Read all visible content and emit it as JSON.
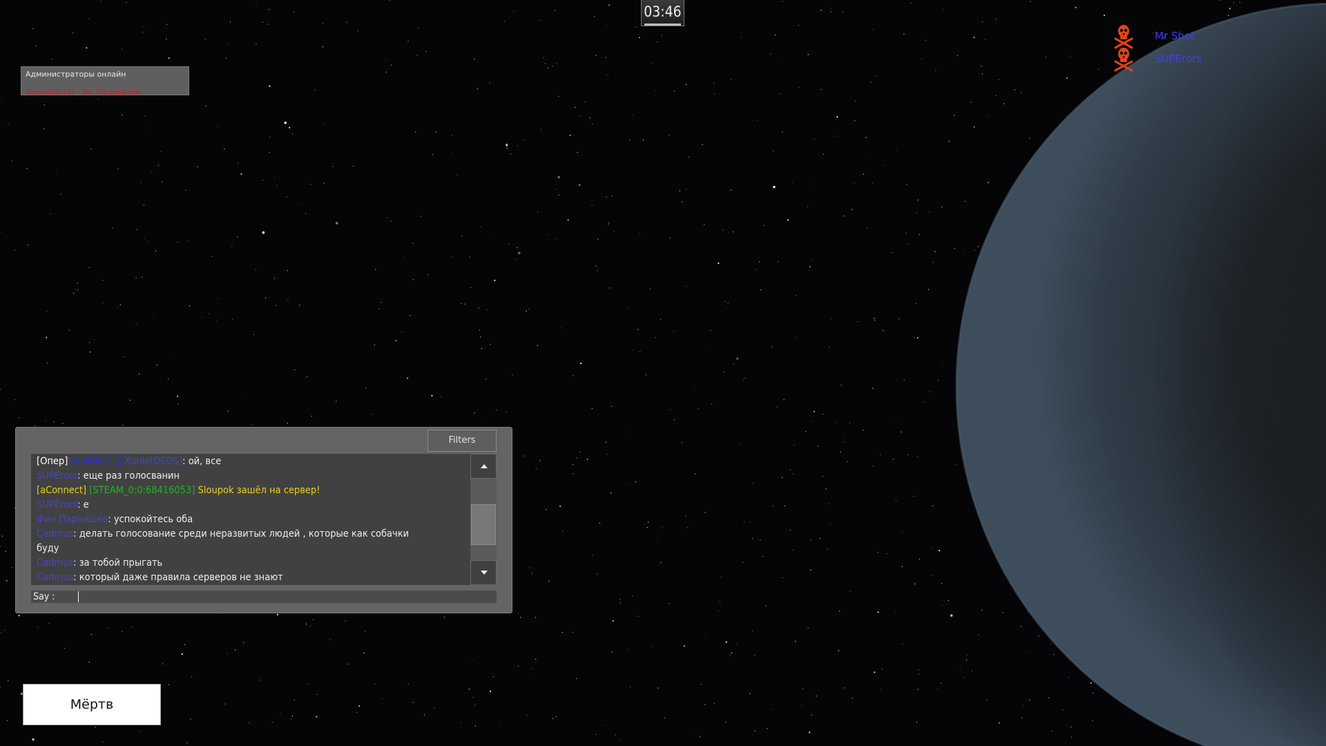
{
  "timer": {
    "value": "03:46"
  },
  "admins_panel": {
    "title": "Администраторы онлайн",
    "entry": "Xonie[DEOS] - Ур. Модератор"
  },
  "killfeed": [
    {
      "name": "Mr Shot"
    },
    {
      "name": "SUPErors"
    }
  ],
  "chat": {
    "filters_label": "Filters",
    "lines": [
      {
        "segments": [
          {
            "text": "[Опер] ",
            "color": "#ffffff"
          },
          {
            "text": "[ADMIN L1] ",
            "color": "#2a2af0"
          },
          {
            "text": "Xonie[DEOS]",
            "color": "#4444c8"
          },
          {
            "text": ": ой, все",
            "color": "#eeeeee"
          }
        ]
      },
      {
        "segments": [
          {
            "text": "SUPErors",
            "color": "#4444c8"
          },
          {
            "text": ": еще раз голосванин",
            "color": "#eeeeee"
          }
        ]
      },
      {
        "segments": [
          {
            "text": "[aConnect] ",
            "color": "#e8d21a"
          },
          {
            "text": "[STEAM_0:0:68416053] ",
            "color": "#22b422"
          },
          {
            "text": "Sloupok ",
            "color": "#e8d21a"
          },
          {
            "text": "зашёл на сервер!",
            "color": "#e8d21a"
          }
        ]
      },
      {
        "segments": [
          {
            "text": "SUPErors",
            "color": "#4444c8"
          },
          {
            "text": ": е",
            "color": "#eeeeee"
          }
        ]
      },
      {
        "segments": [
          {
            "text": "Фин Парнишка",
            "color": "#4444c8"
          },
          {
            "text": ": успокойтесь оба",
            "color": "#eeeeee"
          }
        ]
      },
      {
        "segments": [
          {
            "text": "Cadmus",
            "color": "#4444c8"
          },
          {
            "text": ": делать голосование среди неразвитых людей , которые как собачки",
            "color": "#eeeeee"
          }
        ]
      },
      {
        "segments": [
          {
            "text": "буду",
            "color": "#eeeeee"
          }
        ]
      },
      {
        "segments": [
          {
            "text": "Cadmus",
            "color": "#4444c8"
          },
          {
            "text": ": за тобой прыгать",
            "color": "#eeeeee"
          }
        ]
      },
      {
        "segments": [
          {
            "text": "Cadmus",
            "color": "#4444c8"
          },
          {
            "text": ": который даже правила серверов не знают",
            "color": "#eeeeee"
          }
        ]
      }
    ],
    "scroll_position": 0.62,
    "scroll_visible_fraction": 0.5,
    "say_label": "Say :",
    "say_value": ""
  },
  "status": {
    "label": "Мёртв"
  },
  "colors": {
    "space": "#050507",
    "panel": "#646465",
    "killfeed_icon": "#e04418",
    "name_blue": "#4444c8"
  },
  "icons": {
    "killfeed": "skull-crossbones-icon",
    "scroll_up": "arrow-up-icon",
    "scroll_down": "arrow-down-icon"
  }
}
